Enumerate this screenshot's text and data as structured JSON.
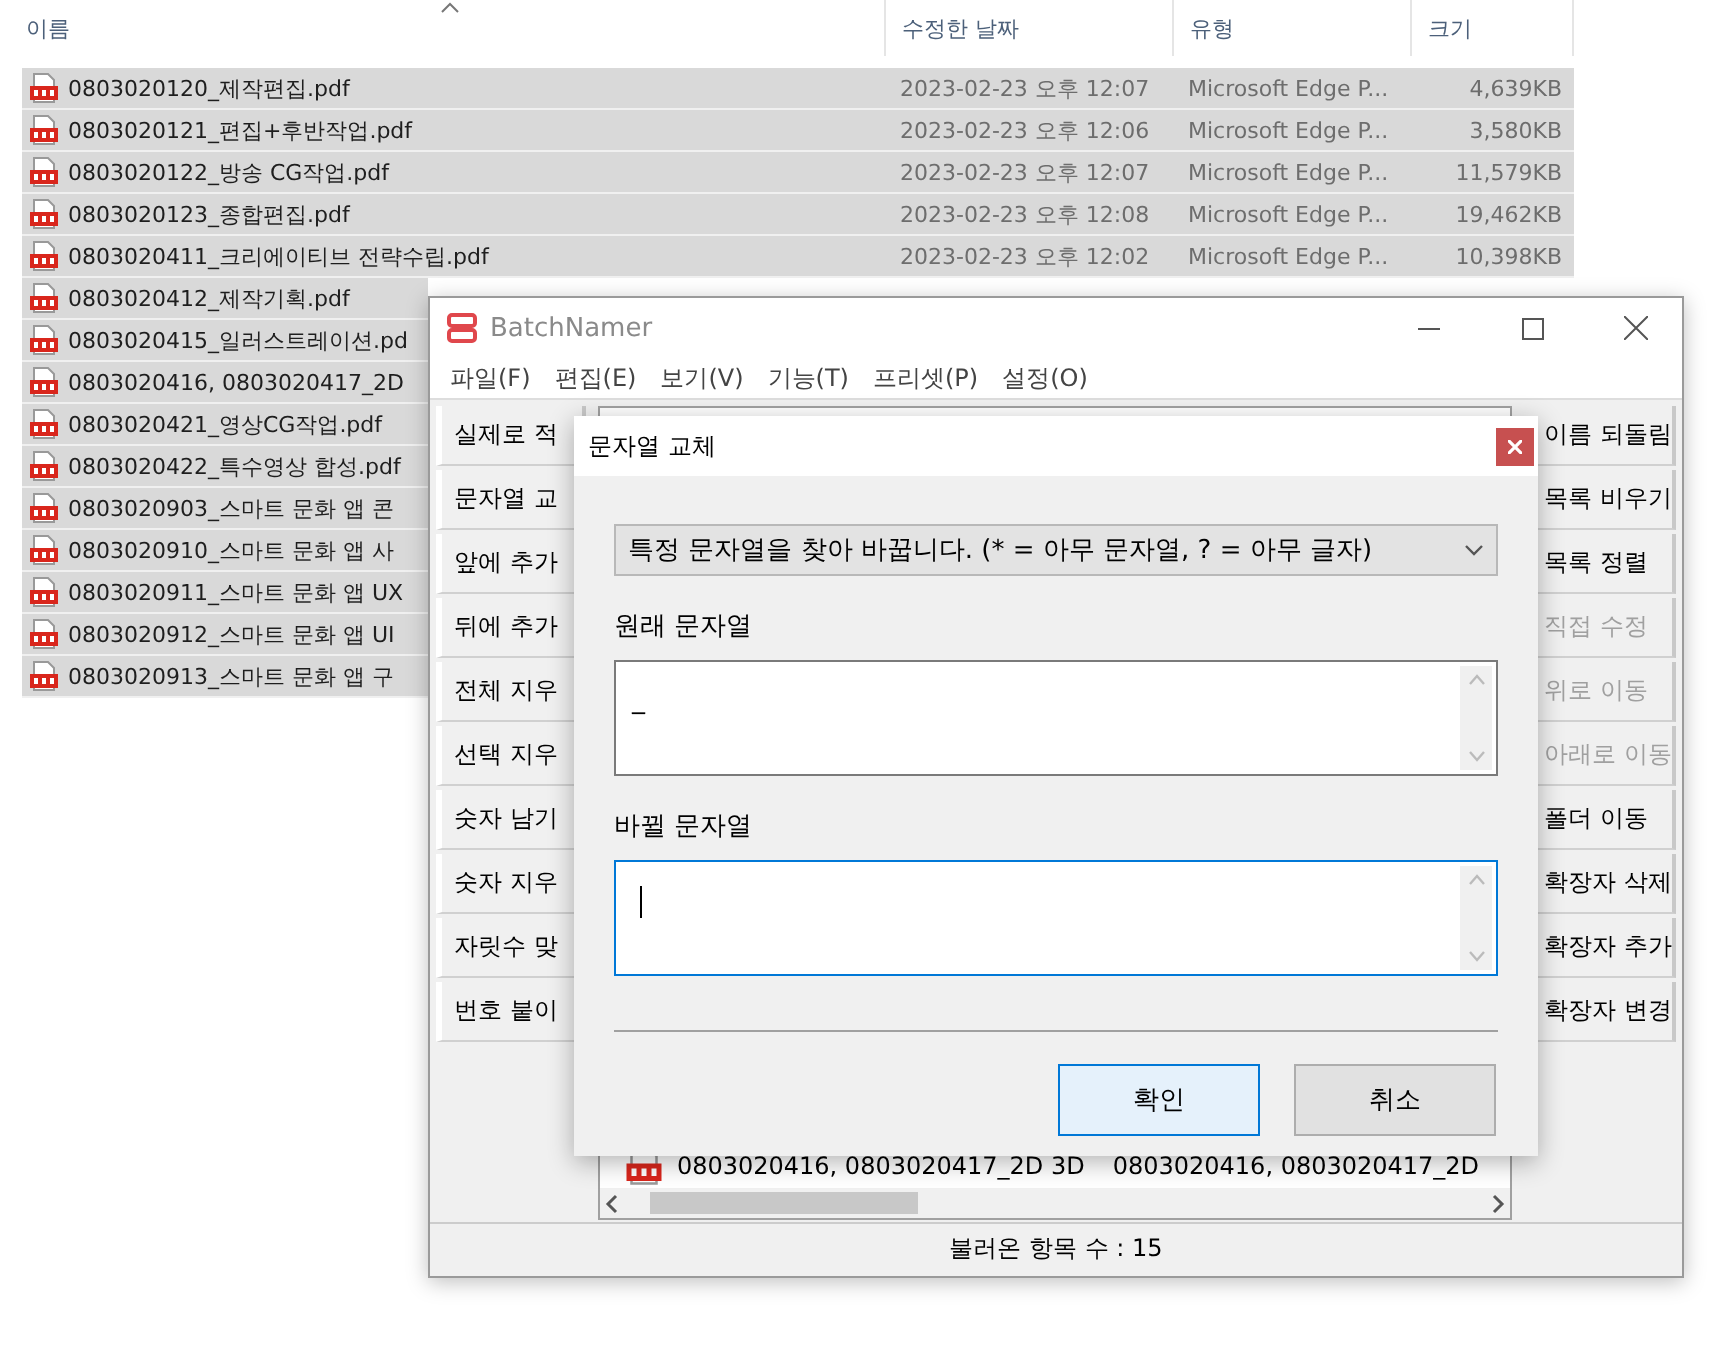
{
  "explorer": {
    "columns": [
      {
        "label": "이름",
        "sorted": true
      },
      {
        "label": "수정한 날짜"
      },
      {
        "label": "유형"
      },
      {
        "label": "크기"
      }
    ],
    "rows": [
      {
        "name": "0803020120_제작편집.pdf",
        "modified": "2023-02-23 오후 12:07",
        "type": "Microsoft Edge P...",
        "size": "4,639KB",
        "selected": true
      },
      {
        "name": "0803020121_편집+후반작업.pdf",
        "modified": "2023-02-23 오후 12:06",
        "type": "Microsoft Edge P...",
        "size": "3,580KB",
        "selected": true
      },
      {
        "name": "0803020122_방송 CG작업.pdf",
        "modified": "2023-02-23 오후 12:07",
        "type": "Microsoft Edge P...",
        "size": "11,579KB",
        "selected": true
      },
      {
        "name": "0803020123_종합편집.pdf",
        "modified": "2023-02-23 오후 12:08",
        "type": "Microsoft Edge P...",
        "size": "19,462KB",
        "selected": true
      },
      {
        "name": "0803020411_크리에이티브 전략수립.pdf",
        "modified": "2023-02-23 오후 12:02",
        "type": "Microsoft Edge P...",
        "size": "10,398KB",
        "selected": true
      },
      {
        "name": "0803020412_제작기획.pdf",
        "selected": true
      },
      {
        "name": "0803020415_일러스트레이션.pd",
        "selected": true
      },
      {
        "name": "0803020416, 0803020417_2D",
        "selected": true
      },
      {
        "name": "0803020421_영상CG작업.pdf",
        "selected": true
      },
      {
        "name": "0803020422_특수영상 합성.pdf",
        "selected": true
      },
      {
        "name": "0803020903_스마트 문화 앱 콘",
        "selected": true
      },
      {
        "name": "0803020910_스마트 문화 앱 사",
        "selected": true
      },
      {
        "name": "0803020911_스마트 문화 앱 UX",
        "selected": true
      },
      {
        "name": "0803020912_스마트 문화 앱 UI",
        "selected": true
      },
      {
        "name": "0803020913_스마트 문화 앱 구",
        "selected": true
      }
    ]
  },
  "app": {
    "title": "BatchNamer",
    "menu": [
      "파일(F)",
      "편집(E)",
      "보기(V)",
      "기능(T)",
      "프리셋(P)",
      "설정(O)"
    ],
    "left_buttons": [
      {
        "label": "실제로 적"
      },
      {
        "label": "문자열 교"
      },
      {
        "label": "앞에 추가"
      },
      {
        "label": "뒤에 추가"
      },
      {
        "label": "전체 지우"
      },
      {
        "label": "선택 지우"
      },
      {
        "label": "숫자 남기"
      },
      {
        "label": "숫자 지우"
      },
      {
        "label": "자릿수 맞"
      },
      {
        "label": "번호 붙이"
      }
    ],
    "right_buttons": [
      {
        "label": "이름 되돌림",
        "disabled": false
      },
      {
        "label": "목록 비우기",
        "disabled": false
      },
      {
        "label": "목록 정렬",
        "disabled": false
      },
      {
        "label": "직접 수정",
        "disabled": true
      },
      {
        "label": "위로 이동",
        "disabled": true
      },
      {
        "label": "아래로 이동",
        "disabled": true
      },
      {
        "label": "폴더 이동",
        "disabled": false
      },
      {
        "label": "확장자 삭제",
        "disabled": false
      },
      {
        "label": "확장자 추가",
        "disabled": false
      },
      {
        "label": "확장자 변경",
        "disabled": false
      }
    ],
    "list_row": {
      "current": "0803020416, 0803020417_2D 3D",
      "new": "0803020416, 0803020417_2D"
    },
    "status_bar": "불러온 항목 수 : 15"
  },
  "dialog": {
    "title": "문자열 교체",
    "mode": "특정 문자열을 찾아 바꿉니다. (* = 아무 문자열, ? = 아무 글자)",
    "fields": [
      {
        "label": "원래 문자열",
        "value": "_",
        "focused": false
      },
      {
        "label": "바뀔 문자열",
        "focused": true
      }
    ],
    "buttons": [
      {
        "label": "확인",
        "default": true
      },
      {
        "label": "취소",
        "default": false
      }
    ]
  }
}
